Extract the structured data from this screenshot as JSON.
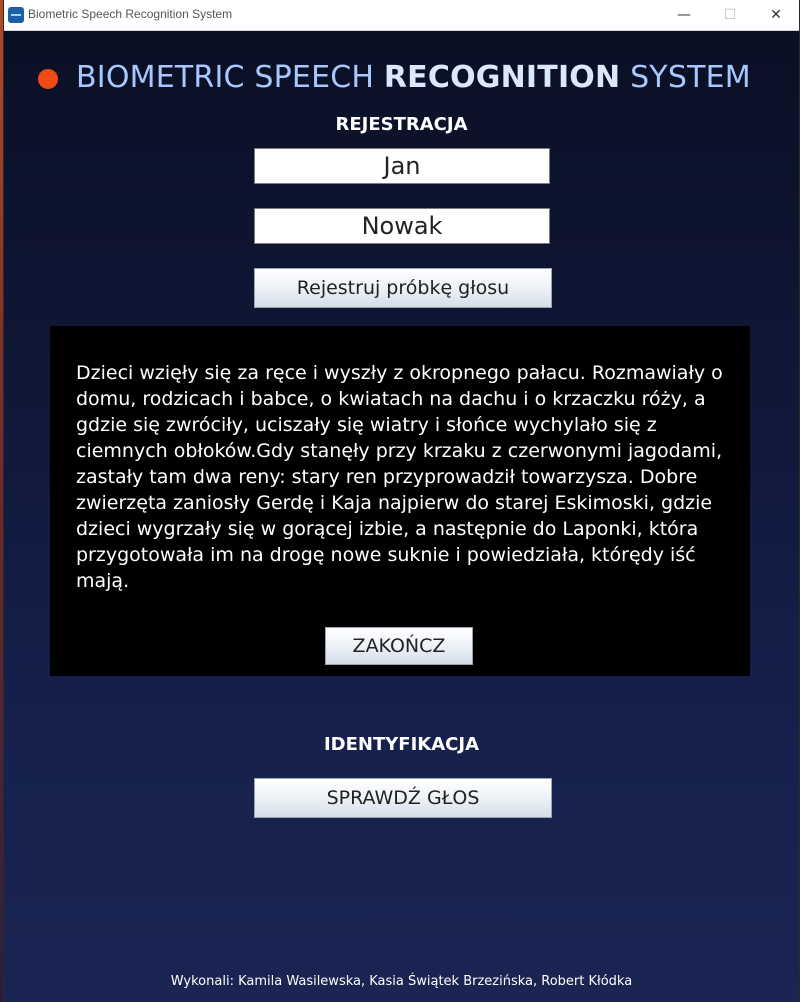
{
  "window": {
    "title": "Biometric Speech Recognition System",
    "controls": {
      "minimize": "—",
      "maximize": "☐",
      "close": "✕"
    }
  },
  "brand": {
    "title_pre": "BIOMETRIC SPEECH ",
    "title_bold": "RECOGNITION",
    "title_post": " SYSTEM",
    "dot_color": "#f04a17"
  },
  "registration": {
    "heading": "REJESTRACJA",
    "first_name": "Jan",
    "last_name": "Nowak",
    "record_button": "Rejestruj próbkę głosu"
  },
  "reading": {
    "text": "Dzieci wzięły się za ręce i wyszły z okropnego pałacu. Rozmawiały o domu, rodzicach i babce, o kwiatach na dachu i o krzaczku róży, a gdzie się zwróciły, uciszały się wiatry i słońce wychylało się z ciemnych obłoków.Gdy stanęły przy krzaku z czerwonymi jagodami, zastały tam dwa reny: stary ren przyprowadził towarzysza. Dobre zwierzęta zaniosły Gerdę i Kaja najpierw do starej Eskimoski, gdzie dzieci wygrzały się w gorącej izbie, a następnie do Laponki, która przygotowała im na drogę nowe suknie i powiedziała, którędy iść mają.",
    "finish_button": "ZAKOŃCZ"
  },
  "identification": {
    "heading": "IDENTYFIKACJA",
    "check_button": "SPRAWDŹ GŁOS"
  },
  "footer": {
    "credits": "Wykonali: Kamila Wasilewska, Kasia Świątek Brzezińska, Robert Kłódka"
  }
}
